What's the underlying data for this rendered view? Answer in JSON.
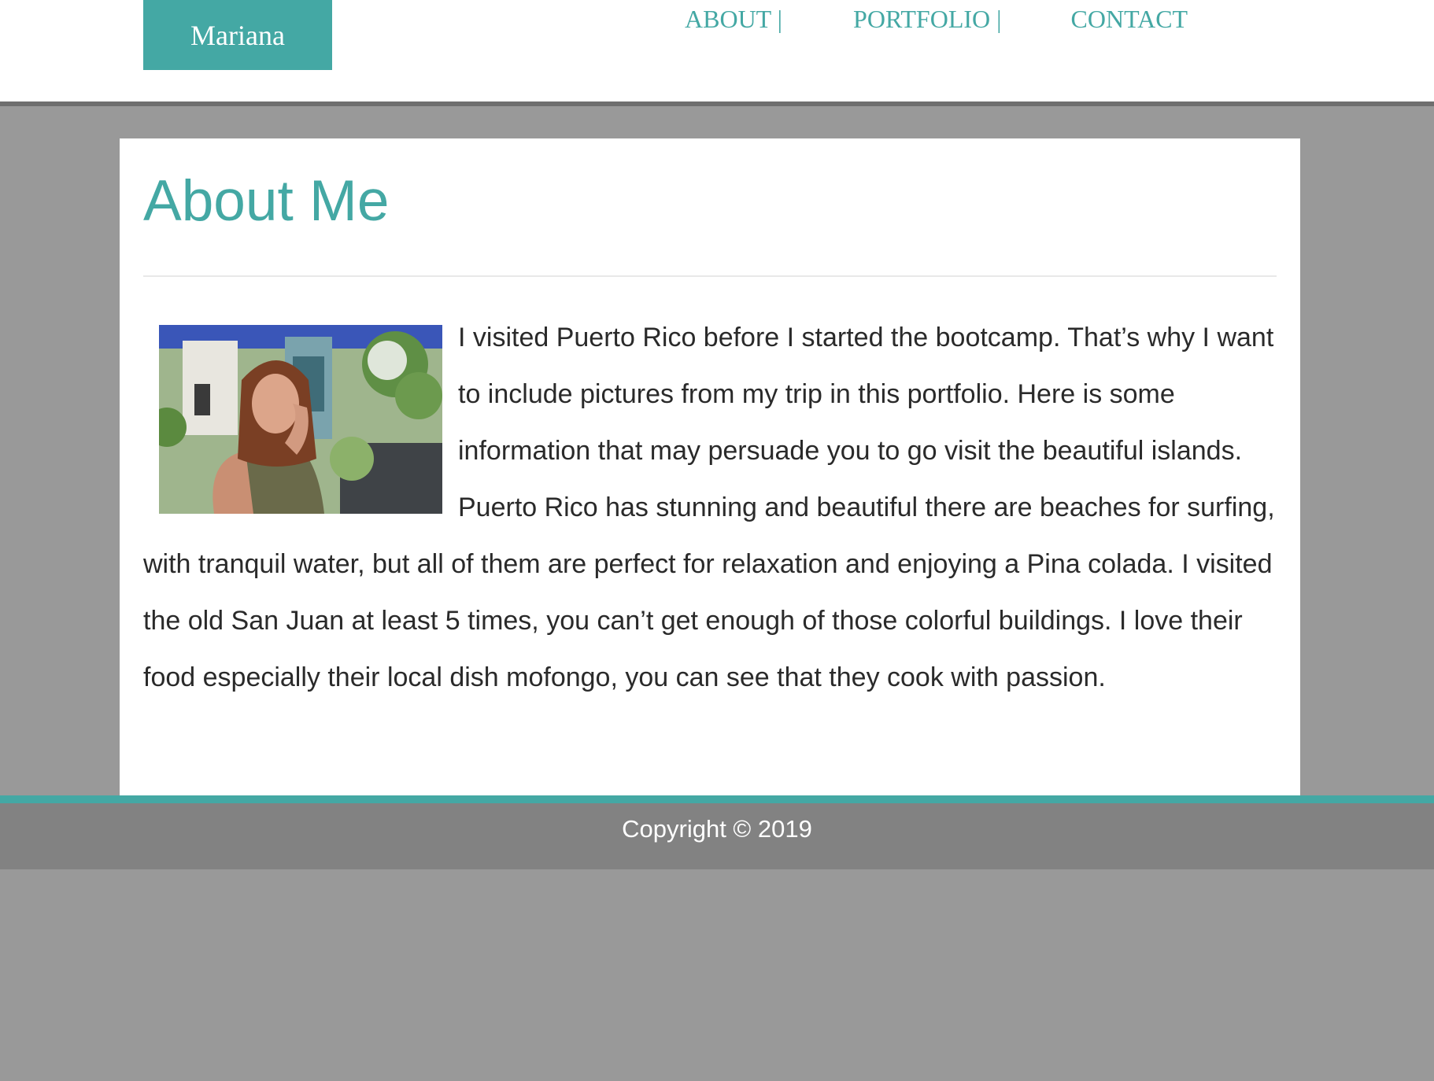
{
  "header": {
    "brand": "Mariana",
    "nav": [
      {
        "label": "ABOUT |"
      },
      {
        "label": "PORTFOLIO |"
      },
      {
        "label": "CONTACT"
      }
    ]
  },
  "main": {
    "title": "About Me",
    "bio": "I visited Puerto Rico before I started the bootcamp. That’s why I want to include pictures from my trip in this portfolio. Here is some information that may persuade you to go visit the beautiful islands. Puerto Rico has stunning and beautiful there are beaches for surfing, with tranquil water, but all of them are perfect for relaxation and enjoying a Pina colada. I visited the old San Juan at least 5 times, you can’t get enough of those colorful buildings. I love their food especially their local dish mofongo, you can see that they cook with passion."
  },
  "footer": {
    "copyright": "Copyright © 2019"
  },
  "colors": {
    "accent": "#44a8a4",
    "page_background": "#999999",
    "footer_background": "#828282"
  }
}
